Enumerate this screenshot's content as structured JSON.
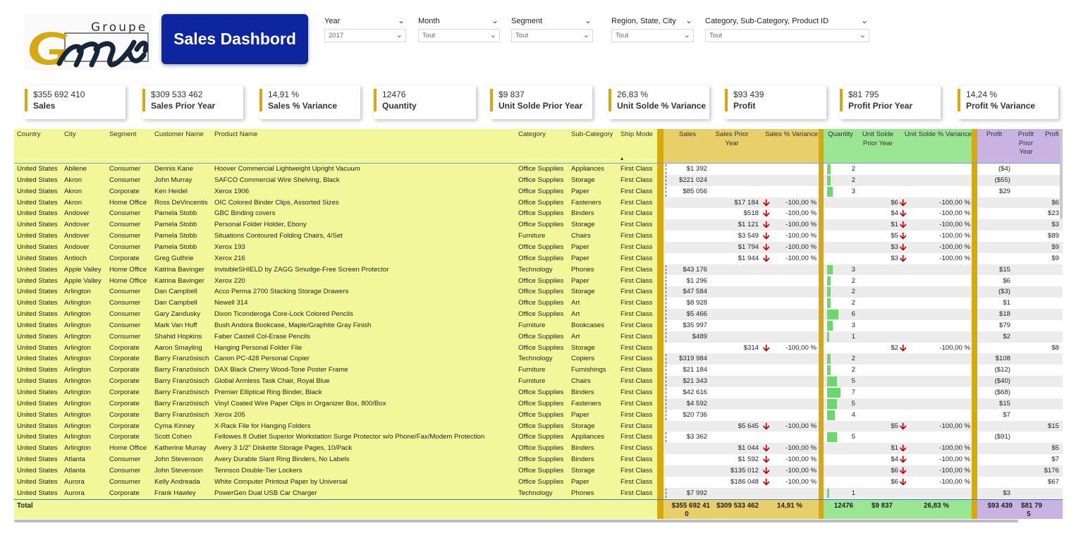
{
  "logo": {
    "top_text": "Groupe",
    "mark_text": "Gmi"
  },
  "title": "Sales Dashbord",
  "filters": [
    {
      "label": "Year",
      "value": "2017"
    },
    {
      "label": "Month",
      "value": "Tout"
    },
    {
      "label": "Segment",
      "value": "Tout"
    },
    {
      "label": "Region, State, City",
      "value": "Tout"
    },
    {
      "label": "Category, Sub-Category, Product ID",
      "value": "Tout"
    }
  ],
  "kpis": [
    {
      "value": "$355 692 410",
      "label": "Sales"
    },
    {
      "value": "$309 533 462",
      "label": "Sales Prior Year"
    },
    {
      "value": "14,91 %",
      "label": "Sales % Variance"
    },
    {
      "value": "12476",
      "label": "Quantity"
    },
    {
      "value": "$9 837",
      "label": "Unit Solde Prior Year"
    },
    {
      "value": "26,83 %",
      "label": "Unit Solde % Variance"
    },
    {
      "value": "$93 439",
      "label": "Profit"
    },
    {
      "value": "$81 795",
      "label": "Profit Prior Year"
    },
    {
      "value": "14,24 %",
      "label": "Profit % Variance"
    }
  ],
  "colors": {
    "title_bg": "#0d259e",
    "accent_gold": "#d6a90e",
    "dim_bg": "#f2f79a",
    "sales_bg": "#e8cf6a",
    "qty_bg": "#9ae693",
    "profit_bg": "#c9b3e3",
    "down_arrow": "#c00000"
  },
  "table": {
    "headers": [
      "Country",
      "City",
      "Segment",
      "Customer Name",
      "Product Name",
      "Category",
      "Sub-Category",
      "Ship Mode",
      "Sales",
      "Sales Prior Year",
      "Sales % Variance",
      "Quantity",
      "Unit Solde Prior Year",
      "Unit Solde % Variance",
      "Profit",
      "Profit Prior Year",
      "Profi"
    ],
    "sort_indicator": "▴",
    "down_icon": "🡫",
    "rows": [
      [
        "United States",
        "Abilene",
        "Consumer",
        "Dennis Kane",
        "Hoover Commercial Lightweight Upright Vacuum",
        "Office Supplies",
        "Appliances",
        "First Class",
        "$1 392",
        "",
        "",
        "2",
        "",
        "",
        "($4)",
        ""
      ],
      [
        "United States",
        "Akron",
        "Consumer",
        "John Murray",
        "SAFCO Commercial Wire Shelving, Black",
        "Office Supplies",
        "Storage",
        "First Class",
        "$221 024",
        "",
        "",
        "2",
        "",
        "",
        "($55)",
        ""
      ],
      [
        "United States",
        "Akron",
        "Corporate",
        "Ken Heidel",
        "Xerox 1906",
        "Office Supplies",
        "Paper",
        "First Class",
        "$85 056",
        "",
        "",
        "3",
        "",
        "",
        "$29",
        ""
      ],
      [
        "United States",
        "Akron",
        "Home Office",
        "Ross DeVincentis",
        "OIC Colored Binder Clips, Assorted Sizes",
        "Office Supplies",
        "Fasteners",
        "First Class",
        "",
        "$17 184",
        "-100,00 %",
        "",
        "$6",
        "-100,00 %",
        "",
        "$6"
      ],
      [
        "United States",
        "Andover",
        "Consumer",
        "Pamela Stobb",
        "GBC Binding covers",
        "Office Supplies",
        "Binders",
        "First Class",
        "",
        "$518",
        "-100,00 %",
        "",
        "$4",
        "-100,00 %",
        "",
        "$23"
      ],
      [
        "United States",
        "Andover",
        "Consumer",
        "Pamela Stobb",
        "Personal Folder Holder, Ebony",
        "Office Supplies",
        "Storage",
        "First Class",
        "",
        "$1 121",
        "-100,00 %",
        "",
        "$1",
        "-100,00 %",
        "",
        "$3"
      ],
      [
        "United States",
        "Andover",
        "Consumer",
        "Pamela Stobb",
        "Situations Contoured Folding Chairs, 4/Set",
        "Furniture",
        "Chairs",
        "First Class",
        "",
        "$3 549",
        "-100,00 %",
        "",
        "$5",
        "-100,00 %",
        "",
        "$89"
      ],
      [
        "United States",
        "Andover",
        "Consumer",
        "Pamela Stobb",
        "Xerox 193",
        "Office Supplies",
        "Paper",
        "First Class",
        "",
        "$1 794",
        "-100,00 %",
        "",
        "$3",
        "-100,00 %",
        "",
        "$9"
      ],
      [
        "United States",
        "Antioch",
        "Corporate",
        "Greg Guthrie",
        "Xerox 216",
        "Office Supplies",
        "Paper",
        "First Class",
        "",
        "$1 944",
        "-100,00 %",
        "",
        "$3",
        "-100,00 %",
        "",
        "$9"
      ],
      [
        "United States",
        "Apple Valley",
        "Home Office",
        "Katrina Bavinger",
        "invisibleSHIELD by ZAGG Smudge-Free Screen Protector",
        "Technology",
        "Phones",
        "First Class",
        "$43 176",
        "",
        "",
        "3",
        "",
        "",
        "$15",
        ""
      ],
      [
        "United States",
        "Apple Valley",
        "Home Office",
        "Katrina Bavinger",
        "Xerox 220",
        "Office Supplies",
        "Paper",
        "First Class",
        "$1 296",
        "",
        "",
        "2",
        "",
        "",
        "$6",
        ""
      ],
      [
        "United States",
        "Arlington",
        "Consumer",
        "Dan Campbell",
        "Acco Perma 2700 Stacking Storage Drawers",
        "Office Supplies",
        "Storage",
        "First Class",
        "$47 584",
        "",
        "",
        "2",
        "",
        "",
        "($3)",
        ""
      ],
      [
        "United States",
        "Arlington",
        "Consumer",
        "Dan Campbell",
        "Newell 314",
        "Office Supplies",
        "Art",
        "First Class",
        "$8 928",
        "",
        "",
        "2",
        "",
        "",
        "$1",
        ""
      ],
      [
        "United States",
        "Arlington",
        "Consumer",
        "Gary Zandusky",
        "Dixon Ticonderoga Core-Lock Colored Pencils",
        "Office Supplies",
        "Art",
        "First Class",
        "$5 466",
        "",
        "",
        "6",
        "",
        "",
        "$18",
        ""
      ],
      [
        "United States",
        "Arlington",
        "Consumer",
        "Mark Van Huff",
        "Bush Andora Bookcase, Maple/Graphite Gray Finish",
        "Furniture",
        "Bookcases",
        "First Class",
        "$35 997",
        "",
        "",
        "3",
        "",
        "",
        "$79",
        ""
      ],
      [
        "United States",
        "Arlington",
        "Consumer",
        "Shahid Hopkins",
        "Faber Castell Col-Erase Pencils",
        "Office Supplies",
        "Art",
        "First Class",
        "$489",
        "",
        "",
        "1",
        "",
        "",
        "$2",
        ""
      ],
      [
        "United States",
        "Arlington",
        "Corporate",
        "Aaron Smayling",
        "Hanging Personal Folder File",
        "Office Supplies",
        "Storage",
        "First Class",
        "",
        "$314",
        "-100,00 %",
        "",
        "$2",
        "-100,00 %",
        "",
        "$8"
      ],
      [
        "United States",
        "Arlington",
        "Corporate",
        "Barry Französisch",
        "Canon PC-428 Personal Copier",
        "Technology",
        "Copiers",
        "First Class",
        "$319 984",
        "",
        "",
        "2",
        "",
        "",
        "$108",
        ""
      ],
      [
        "United States",
        "Arlington",
        "Corporate",
        "Barry Französisch",
        "DAX Black Cherry Wood-Tone Poster Frame",
        "Furniture",
        "Furnishings",
        "First Class",
        "$21 184",
        "",
        "",
        "2",
        "",
        "",
        "($12)",
        ""
      ],
      [
        "United States",
        "Arlington",
        "Corporate",
        "Barry Französisch",
        "Global Armless Task Chair, Royal Blue",
        "Furniture",
        "Chairs",
        "First Class",
        "$21 343",
        "",
        "",
        "5",
        "",
        "",
        "($40)",
        ""
      ],
      [
        "United States",
        "Arlington",
        "Corporate",
        "Barry Französisch",
        "Premier Elliptical Ring Binder, Black",
        "Office Supplies",
        "Binders",
        "First Class",
        "$42 616",
        "",
        "",
        "7",
        "",
        "",
        "($68)",
        ""
      ],
      [
        "United States",
        "Arlington",
        "Corporate",
        "Barry Französisch",
        "Vinyl Coated Wire Paper Clips in Organizer Box, 800/Box",
        "Office Supplies",
        "Fasteners",
        "First Class",
        "$4 592",
        "",
        "",
        "5",
        "",
        "",
        "$15",
        ""
      ],
      [
        "United States",
        "Arlington",
        "Corporate",
        "Barry Französisch",
        "Xerox 205",
        "Office Supplies",
        "Paper",
        "First Class",
        "$20 736",
        "",
        "",
        "4",
        "",
        "",
        "$7",
        ""
      ],
      [
        "United States",
        "Arlington",
        "Corporate",
        "Cyma Kinney",
        "X-Rack File for Hanging Folders",
        "Office Supplies",
        "Storage",
        "First Class",
        "",
        "$5 645",
        "-100,00 %",
        "",
        "$5",
        "-100,00 %",
        "",
        "$15"
      ],
      [
        "United States",
        "Arlington",
        "Corporate",
        "Scott Cohen",
        "Fellowes 8 Outlet Superior Workstation Surge Protector w/o Phone/Fax/Modem Protection",
        "Office Supplies",
        "Appliances",
        "First Class",
        "$3 362",
        "",
        "",
        "5",
        "",
        "",
        "($91)",
        ""
      ],
      [
        "United States",
        "Arlington",
        "Home Office",
        "Katherine Murray",
        "Avery 3 1/2\" Diskette Storage Pages, 10/Pack",
        "Office Supplies",
        "Binders",
        "First Class",
        "",
        "$1 044",
        "-100,00 %",
        "",
        "$1",
        "-100,00 %",
        "",
        "$5"
      ],
      [
        "United States",
        "Atlanta",
        "Consumer",
        "John Stevenson",
        "Avery Durable Slant Ring Binders, No Labels",
        "Office Supplies",
        "Binders",
        "First Class",
        "",
        "$1 592",
        "-100,00 %",
        "",
        "$4",
        "-100,00 %",
        "",
        "$7"
      ],
      [
        "United States",
        "Atlanta",
        "Consumer",
        "John Stevenson",
        "Tennsco Double-Tier Lockers",
        "Office Supplies",
        "Storage",
        "First Class",
        "",
        "$135 012",
        "-100,00 %",
        "",
        "$6",
        "-100,00 %",
        "",
        "$176"
      ],
      [
        "United States",
        "Aurora",
        "Consumer",
        "Kelly Andreada",
        "White Computer Printout Paper by Universal",
        "Office Supplies",
        "Paper",
        "First Class",
        "",
        "$186 048",
        "-100,00 %",
        "",
        "$6",
        "-100,00 %",
        "",
        "$67"
      ],
      [
        "United States",
        "Aurora",
        "Corporate",
        "Frank Hawley",
        "PowerGen Dual USB Car Charger",
        "Technology",
        "Phones",
        "First Class",
        "$7 992",
        "",
        "",
        "1",
        "",
        "",
        "$3",
        ""
      ]
    ],
    "total": {
      "label": "Total",
      "sales_line1": "$355 692 41",
      "sales_line2": "0",
      "sales_py": "$309 533 462",
      "sales_var": "14,91 %",
      "qty": "12476",
      "unit_py": "$9 837",
      "unit_var": "26,83 %",
      "profit": "$93 439",
      "profit_py_line1": "$81 79",
      "profit_py_line2": "5"
    }
  }
}
